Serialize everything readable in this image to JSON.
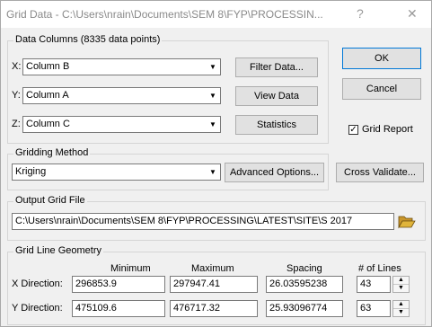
{
  "window": {
    "title": "Grid Data - C:\\Users\\nrain\\Documents\\SEM 8\\FYP\\PROCESSIN...",
    "help_glyph": "?",
    "close_glyph": "✕"
  },
  "data_columns": {
    "heading": "Data Columns   (8335 data points)",
    "x_label": "X:",
    "x_value": "Column B",
    "y_label": "Y:",
    "y_value": "Column A",
    "z_label": "Z:",
    "z_value": "Column C"
  },
  "buttons": {
    "ok": "OK",
    "cancel": "Cancel",
    "filter_data": "Filter Data...",
    "view_data": "View Data",
    "statistics": "Statistics",
    "advanced_options": "Advanced Options...",
    "cross_validate": "Cross Validate..."
  },
  "grid_report": {
    "label": "Grid Report",
    "checked": true,
    "check_glyph": "✓"
  },
  "gridding_method": {
    "heading": "Gridding Method",
    "value": "Kriging"
  },
  "output_grid_file": {
    "heading": "Output Grid File",
    "path": "C:\\Users\\nrain\\Documents\\SEM 8\\FYP\\PROCESSING\\LATEST\\SITE\\S 2017"
  },
  "grid_line_geometry": {
    "heading": "Grid Line Geometry",
    "headers": {
      "minimum": "Minimum",
      "maximum": "Maximum",
      "spacing": "Spacing",
      "lines": "# of Lines"
    },
    "x": {
      "label": "X Direction:",
      "minimum": "296853.9",
      "maximum": "297947.41",
      "spacing": "26.03595238",
      "lines": "43"
    },
    "y": {
      "label": "Y Direction:",
      "minimum": "475109.6",
      "maximum": "476717.32",
      "spacing": "25.93096774",
      "lines": "63"
    }
  },
  "glyphs": {
    "dropdown": "▼",
    "spin_up": "▲",
    "spin_down": "▼"
  },
  "colors": {
    "folder_icon": "#e0b43a",
    "window_bg": "#f0f0f0",
    "title_text": "#8a8a8a"
  }
}
